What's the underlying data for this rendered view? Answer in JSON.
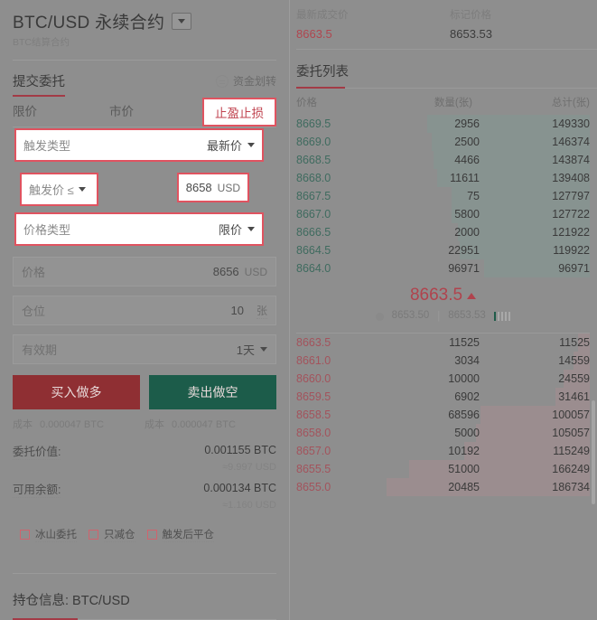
{
  "symbol": {
    "title": "BTC/USD 永续合约",
    "subtitle": "BTC结算合约",
    "caret_icon": "chevron-down-icon"
  },
  "order_form": {
    "section_title": "提交委托",
    "transfer_label": "资金划转",
    "transfer_icon": "transfer-icon",
    "tabs": [
      {
        "label": "限价",
        "active": false
      },
      {
        "label": "市价",
        "active": false
      },
      {
        "label": "止盈止损",
        "active": true,
        "highlighted": true
      }
    ],
    "fields": {
      "trigger_type": {
        "label": "触发类型",
        "value": "最新价",
        "highlighted": true,
        "caret_icon": "chevron-down-icon"
      },
      "trigger_price_op": {
        "label": "触发价 ≤",
        "highlighted": true,
        "caret_icon": "chevron-down-icon"
      },
      "trigger_price": {
        "value": "8658",
        "unit": "USD",
        "highlighted": true
      },
      "price_type": {
        "label": "价格类型",
        "value": "限价",
        "highlighted": true,
        "caret_icon": "chevron-down-icon"
      },
      "price": {
        "label": "价格",
        "value": "8656",
        "unit": "USD"
      },
      "position": {
        "label": "仓位",
        "value": "10",
        "unit": "张"
      },
      "validity": {
        "label": "有效期",
        "value": "1天",
        "caret_icon": "chevron-down-icon"
      }
    },
    "buttons": {
      "buy": "买入做多",
      "sell": "卖出做空"
    },
    "cost": {
      "buy_label": "成本",
      "buy_value": "0.000047 BTC",
      "sell_label": "成本",
      "sell_value": "0.000047 BTC"
    },
    "summary": [
      {
        "key": "委托价值:",
        "value": "0.001155 BTC",
        "approx": "≈9.997 USD"
      },
      {
        "key": "可用余额:",
        "value": "0.000134 BTC",
        "approx": "≈1.160 USD"
      }
    ],
    "checkboxes": [
      {
        "label": "冰山委托",
        "checked": false
      },
      {
        "label": "只减仓",
        "checked": false
      },
      {
        "label": "触发后平仓",
        "checked": false
      }
    ]
  },
  "position_info": {
    "title": "持仓信息: BTC/USD"
  },
  "ticker": {
    "last_price_label": "最新成交价",
    "last_price": "8663.5",
    "mark_price_label": "标记价格",
    "mark_price": "8653.53"
  },
  "orderbook": {
    "title": "委托列表",
    "columns": [
      "价格",
      "数量(张)",
      "总计(张)"
    ],
    "asks": [
      {
        "price": "8669.5",
        "amount": "2956",
        "total": "149330",
        "depth": 80
      },
      {
        "price": "8669.0",
        "amount": "2500",
        "total": "146374",
        "depth": 78
      },
      {
        "price": "8668.5",
        "amount": "4466",
        "total": "143874",
        "depth": 77
      },
      {
        "price": "8668.0",
        "amount": "11611",
        "total": "139408",
        "depth": 75
      },
      {
        "price": "8667.5",
        "amount": "75",
        "total": "127797",
        "depth": 68
      },
      {
        "price": "8667.0",
        "amount": "5800",
        "total": "127722",
        "depth": 68
      },
      {
        "price": "8666.5",
        "amount": "2000",
        "total": "121922",
        "depth": 65
      },
      {
        "price": "8664.5",
        "amount": "22951",
        "total": "119922",
        "depth": 64
      },
      {
        "price": "8664.0",
        "amount": "96971",
        "total": "96971",
        "depth": 52
      }
    ],
    "mid": {
      "price": "8663.5",
      "direction_icon": "arrow-up-icon",
      "index_price": "8653.50",
      "index_icon": "globe-icon",
      "mark_price": "8653.53",
      "bars_total": 5,
      "bars_filled": 1
    },
    "bids": [
      {
        "price": "8663.5",
        "amount": "11525",
        "total": "11525",
        "depth": 6
      },
      {
        "price": "8661.0",
        "amount": "3034",
        "total": "14559",
        "depth": 8
      },
      {
        "price": "8660.0",
        "amount": "10000",
        "total": "24559",
        "depth": 13
      },
      {
        "price": "8659.5",
        "amount": "6902",
        "total": "31461",
        "depth": 17
      },
      {
        "price": "8658.5",
        "amount": "68596",
        "total": "100057",
        "depth": 54
      },
      {
        "price": "8658.0",
        "amount": "5000",
        "total": "105057",
        "depth": 56
      },
      {
        "price": "8657.0",
        "amount": "10192",
        "total": "115249",
        "depth": 62
      },
      {
        "price": "8655.5",
        "amount": "51000",
        "total": "166249",
        "depth": 89
      },
      {
        "price": "8655.0",
        "amount": "20485",
        "total": "186734",
        "depth": 100
      }
    ]
  },
  "colors": {
    "accent_red": "#a33b46",
    "highlight_red": "#e05360",
    "buy": "#8f2f33",
    "sell": "#1c5c4a",
    "ask_text": "#3f6b5f",
    "bid_text": "#a3535c"
  }
}
